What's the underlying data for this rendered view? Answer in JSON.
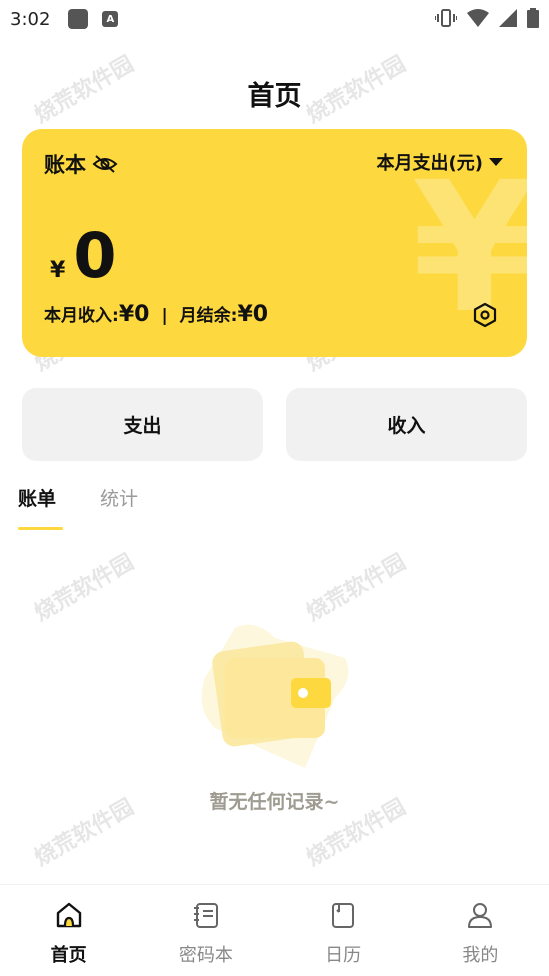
{
  "status_bar": {
    "time": "3:02",
    "notif_icon": "A"
  },
  "header": {
    "title": "首页"
  },
  "card": {
    "book_label": "账本",
    "period_label": "本月支出(元)",
    "currency_symbol": "¥",
    "amount": "0",
    "watermark_symbol": "¥",
    "income_label": "本月收入:",
    "income_value": "¥0",
    "separator": "|",
    "balance_label": "月结余:",
    "balance_value": "¥0"
  },
  "actions": {
    "expense_label": "支出",
    "income_label": "收入"
  },
  "tabs": {
    "bills": "账单",
    "stats": "统计"
  },
  "empty": {
    "text": "暂无任何记录~"
  },
  "watermark": {
    "text": "烧荒软件园"
  },
  "nav": {
    "home": "首页",
    "passwords": "密码本",
    "calendar": "日历",
    "mine": "我的"
  },
  "colors": {
    "accent": "#fdd83e",
    "button_bg": "#f1f1f1",
    "muted_text": "#9e9b91"
  }
}
